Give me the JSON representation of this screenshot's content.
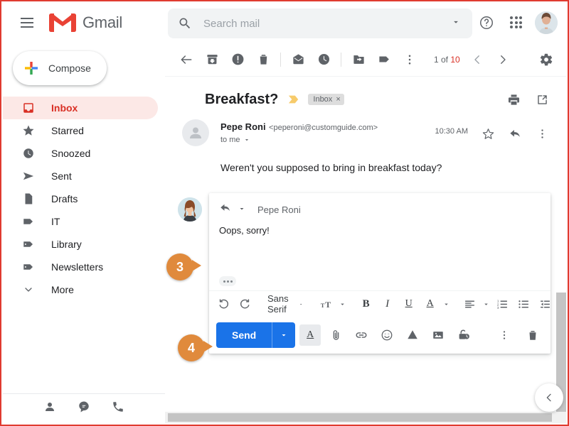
{
  "header": {
    "menu_icon": "hamburger-icon",
    "brand": "Gmail",
    "search_placeholder": "Search mail",
    "search_value": "",
    "search_icon": "search-icon",
    "search_options_icon": "chevron-down-icon",
    "help_icon": "help-icon",
    "apps_icon": "apps-grid-icon",
    "avatar_icon": "user-avatar"
  },
  "sidebar": {
    "compose_label": "Compose",
    "items": [
      {
        "label": "Inbox",
        "icon": "inbox-icon",
        "active": true
      },
      {
        "label": "Starred",
        "icon": "star-icon",
        "active": false
      },
      {
        "label": "Snoozed",
        "icon": "clock-icon",
        "active": false
      },
      {
        "label": "Sent",
        "icon": "send-icon",
        "active": false
      },
      {
        "label": "Drafts",
        "icon": "document-icon",
        "active": false
      },
      {
        "label": "IT",
        "icon": "label-icon",
        "active": false
      },
      {
        "label": "Library",
        "icon": "label-icon",
        "active": false
      },
      {
        "label": "Newsletters",
        "icon": "label-icon",
        "active": false
      },
      {
        "label": "More",
        "icon": "chevron-down-icon",
        "active": false
      }
    ],
    "bottom_icons": [
      "contacts-icon",
      "chat-icon",
      "phone-icon"
    ]
  },
  "toolbar": {
    "back_icon": "back-arrow-icon",
    "archive_icon": "archive-icon",
    "spam_icon": "report-spam-icon",
    "delete_icon": "trash-icon",
    "unread_icon": "mark-unread-icon",
    "snooze_icon": "clock-icon",
    "move_icon": "move-to-folder-icon",
    "labels_icon": "label-icon",
    "more_icon": "more-vertical-icon",
    "pager_prefix": "1 of ",
    "pager_count": "10",
    "prev_icon": "chevron-left-icon",
    "next_icon": "chevron-right-icon",
    "settings_icon": "gear-icon"
  },
  "email": {
    "subject": "Breakfast?",
    "importance_icon": "importance-marker-icon",
    "label_chip": "Inbox",
    "label_chip_remove": "×",
    "print_icon": "print-icon",
    "popout_icon": "open-in-new-icon",
    "sender_name": "Pepe Roni",
    "sender_email": "<peperoni@customguide.com>",
    "recipient": "to me",
    "recipient_caret": "caret-down-icon",
    "time": "10:30  AM",
    "star_icon": "star-outline-icon",
    "reply_icon": "reply-icon",
    "more_icon": "more-vertical-icon",
    "body": "Weren't you supposed to bring in breakfast today?"
  },
  "reply": {
    "reply_icon": "reply-icon",
    "type_caret": "caret-down-icon",
    "recipient": "Pepe Roni",
    "body": "Oops, sorry!",
    "expand_icon": "more-options-dots-icon",
    "format": {
      "undo_icon": "undo-icon",
      "redo_icon": "redo-icon",
      "font_name": "Sans Serif",
      "font_caret": "caret-down-icon",
      "size_icon": "font-size-icon",
      "size_caret": "caret-down-icon",
      "bold": "B",
      "italic": "I",
      "underline": "U",
      "text_color": "A",
      "color_caret": "caret-down-icon",
      "align_icon": "align-left-icon",
      "align_caret": "caret-down-icon",
      "numbered_list_icon": "numbered-list-icon",
      "bullet_list_icon": "bullet-list-icon",
      "indent_icon": "indent-icon",
      "overflow_caret": "caret-down-icon"
    },
    "send_label": "Send",
    "send_caret": "caret-down-icon",
    "actions": [
      "format-text-icon",
      "attach-file-icon",
      "insert-link-icon",
      "insert-emoji-icon",
      "google-drive-icon",
      "insert-photo-icon",
      "confidential-mode-icon"
    ],
    "more_icon": "more-vertical-icon",
    "discard_icon": "trash-icon"
  },
  "callouts": [
    {
      "number": "3"
    },
    {
      "number": "4"
    }
  ],
  "colors": {
    "brand_red": "#d93025",
    "active_pill": "#fce8e6",
    "send_blue": "#1a73e8",
    "callout_orange": "#e08a3c",
    "border_red": "#e03b30"
  },
  "footer": {
    "collapse_icon": "chevron-left-icon"
  }
}
